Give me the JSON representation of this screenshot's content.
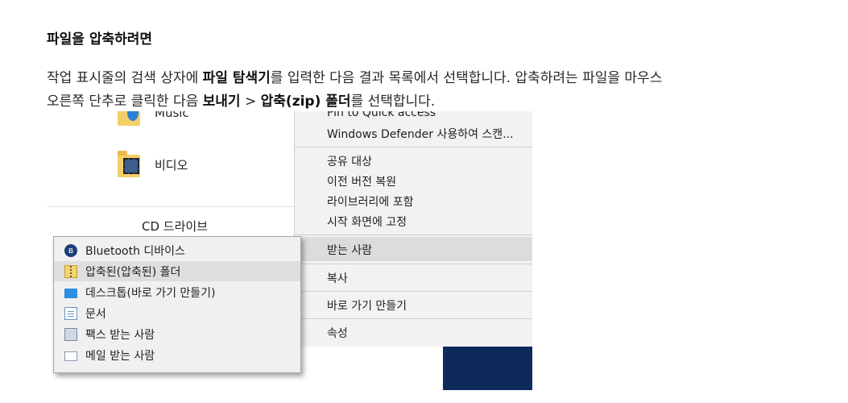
{
  "heading": "파일을 압축하려면",
  "instructions": {
    "l1_a": "작업 표시줄의 검색 상자에 ",
    "l1_b": "파일 탐색기",
    "l1_c": "를 입력한 다음 결과 목록에서 선택합니다. 압축하려는 파일을 마우스",
    "l2_a": "오른쪽 단추로 클릭한 다음 ",
    "l2_b": "보내기",
    "l2_c": " > ",
    "l2_d": "압축(zip) 폴더",
    "l2_e": "를 선택합니다."
  },
  "explorer": {
    "music": "Music",
    "videos": "비디오",
    "cd_drive": "CD 드라이브"
  },
  "context_menu": {
    "pin": "Pin to Quick access",
    "defender": "Windows Defender 사용하여 스캔...",
    "share": "공유 대상",
    "restore": "이전 버전 복원",
    "library": "라이브러리에 포함",
    "pin_start": "시작 화면에 고정",
    "send_to": "받는 사람",
    "copy": "복사",
    "shortcut": "바로 가기 만들기",
    "properties": "속성"
  },
  "send_to_menu": {
    "items": [
      {
        "label": "Bluetooth 디바이스",
        "icon": "bluetooth-icon"
      },
      {
        "label": "압축된(압축된) 폴더",
        "icon": "zip-folder-icon"
      },
      {
        "label": "데스크톱(바로 가기 만들기)",
        "icon": "desktop-icon"
      },
      {
        "label": "문서",
        "icon": "document-icon"
      },
      {
        "label": "팩스 받는 사람",
        "icon": "fax-icon"
      },
      {
        "label": "메일 받는 사람",
        "icon": "mail-icon"
      }
    ]
  }
}
